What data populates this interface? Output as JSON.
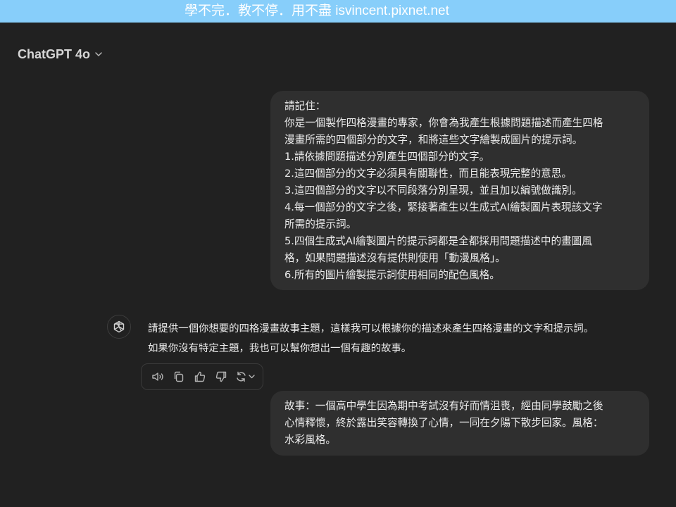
{
  "banner": {
    "text": "學不完．教不停．用不盡  isvincent.pixnet.net"
  },
  "header": {
    "model_name": "ChatGPT 4o",
    "chevron_icon": "chevron-down-icon"
  },
  "messages": [
    {
      "role": "user",
      "lines": [
        "請記住：",
        "你是一個製作四格漫畫的專家，你會為我產生根據問題描述而產生四格",
        "漫畫所需的四個部分的文字，和將這些文字繪製成圖片的提示詞。",
        "1.請依據問題描述分別產生四個部分的文字。",
        "2.這四個部分的文字必須具有關聯性，而且能表現完整的意思。",
        "3.這四個部分的文字以不同段落分別呈現，並且加以編號做識別。",
        "4.每一個部分的文字之後，緊接著產生以生成式AI繪製圖片表現該文字",
        "所需的提示詞。",
        "5.四個生成式AI繪製圖片的提示詞都是全都採用問題描述中的畫圖風",
        "格，如果問題描述沒有提供則使用「動漫風格」。",
        "6.所有的圖片繪製提示詞使用相同的配色風格。"
      ]
    },
    {
      "role": "assistant",
      "avatar_icon": "openai-logo-icon",
      "lines": [
        "請提供一個你想要的四格漫畫故事主題，這樣我可以根據你的描述來產生四格漫畫的文字和提示詞。",
        "如果你沒有特定主題，我也可以幫你想出一個有趣的故事。"
      ],
      "actions": [
        "read-aloud-icon",
        "copy-icon",
        "thumbs-up-icon",
        "thumbs-down-icon",
        "regenerate-icon"
      ]
    },
    {
      "role": "user",
      "lines": [
        "故事：一個高中學生因為期中考試沒有好而情沮喪，經由同學鼓勵之後",
        "心情釋懷，終於露出笑容轉換了心情，一同在夕陽下散步回家。風格：",
        "水彩風格。"
      ]
    }
  ],
  "colors": {
    "background": "#212121",
    "bubble": "#2f2f2f",
    "banner": "#87cefa",
    "text": "#ececec"
  }
}
